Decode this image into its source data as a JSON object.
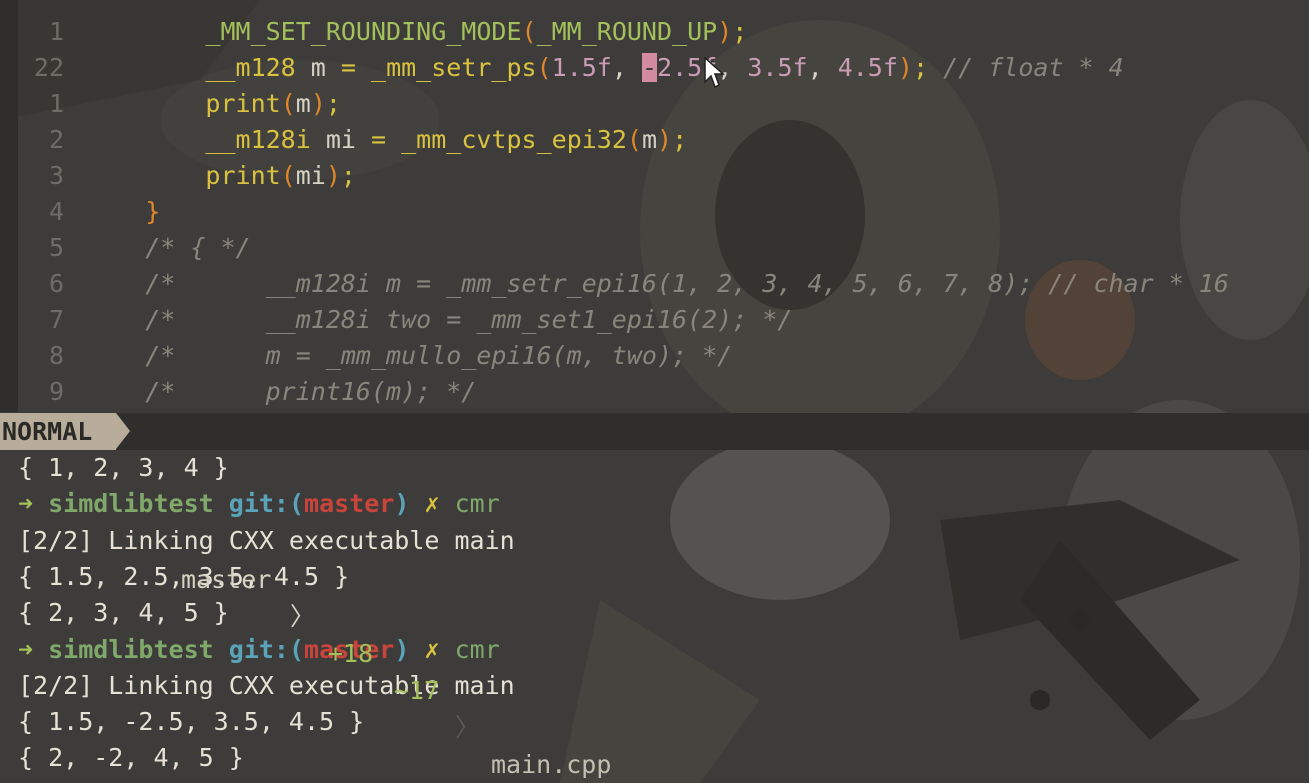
{
  "editor": {
    "lines": [
      {
        "num": "1",
        "tokens": [
          [
            "        ",
            "id"
          ],
          [
            "_MM_SET_ROUNDING_MODE",
            "kw-fn"
          ],
          [
            "(",
            "paren"
          ],
          [
            "_MM_ROUND_UP",
            "kw-fn"
          ],
          [
            ")",
            "paren"
          ],
          [
            ";",
            "op"
          ]
        ]
      },
      {
        "num": "22",
        "tokens": [
          [
            "        ",
            "id"
          ],
          [
            "__m128",
            "kw-fn2"
          ],
          [
            " m ",
            "id"
          ],
          [
            "=",
            "op"
          ],
          [
            " ",
            "id"
          ],
          [
            "_mm_setr_ps",
            "kw-fn2"
          ],
          [
            "(",
            "paren"
          ],
          [
            "1.5f",
            "num"
          ],
          [
            ", ",
            "id"
          ],
          [
            "-",
            "cursor-block"
          ],
          [
            "2.5f",
            "num"
          ],
          [
            ", ",
            "id"
          ],
          [
            "3.5f",
            "num"
          ],
          [
            ", ",
            "id"
          ],
          [
            "4.5f",
            "num"
          ],
          [
            ")",
            "paren"
          ],
          [
            ";",
            "op"
          ],
          [
            " // float * 4",
            "cm"
          ]
        ]
      },
      {
        "num": "1",
        "tokens": [
          [
            "        ",
            "id"
          ],
          [
            "print",
            "kw-fn2"
          ],
          [
            "(",
            "paren"
          ],
          [
            "m",
            "id"
          ],
          [
            ")",
            "paren"
          ],
          [
            ";",
            "op"
          ]
        ]
      },
      {
        "num": "2",
        "tokens": [
          [
            "        ",
            "id"
          ],
          [
            "__m128i",
            "kw-fn2"
          ],
          [
            " mi ",
            "id"
          ],
          [
            "=",
            "op"
          ],
          [
            " ",
            "id"
          ],
          [
            "_mm_cvtps_epi32",
            "kw-fn2"
          ],
          [
            "(",
            "paren"
          ],
          [
            "m",
            "id"
          ],
          [
            ")",
            "paren"
          ],
          [
            ";",
            "op"
          ]
        ]
      },
      {
        "num": "3",
        "tokens": [
          [
            "        ",
            "id"
          ],
          [
            "print",
            "kw-fn2"
          ],
          [
            "(",
            "paren"
          ],
          [
            "mi",
            "id"
          ],
          [
            ")",
            "paren"
          ],
          [
            ";",
            "op"
          ]
        ]
      },
      {
        "num": "4",
        "tokens": [
          [
            "    ",
            "id"
          ],
          [
            "}",
            "paren"
          ]
        ]
      },
      {
        "num": "5",
        "tokens": [
          [
            "    ",
            "id"
          ],
          [
            "/* { */",
            "cm"
          ]
        ]
      },
      {
        "num": "6",
        "tokens": [
          [
            "    ",
            "id"
          ],
          [
            "/*      __m128i m = _mm_setr_epi16(1, 2, 3, 4, 5, 6, 7, 8); // char * 16",
            "cm"
          ]
        ]
      },
      {
        "num": "7",
        "tokens": [
          [
            "    ",
            "id"
          ],
          [
            "/*      __m128i two = _mm_set1_epi16(2); */",
            "cm"
          ]
        ]
      },
      {
        "num": "8",
        "tokens": [
          [
            "    ",
            "id"
          ],
          [
            "/*      m = _mm_mullo_epi16(m, two); */",
            "cm"
          ]
        ]
      },
      {
        "num": "9",
        "tokens": [
          [
            "    ",
            "id"
          ],
          [
            "/*      print16(m); */",
            "cm"
          ]
        ]
      }
    ]
  },
  "statusline": {
    "mode": "NORMAL",
    "branch_icon": "",
    "branch": "master",
    "separator": "〉",
    "added": "+18",
    "modified": "~17",
    "filename": "main.cpp"
  },
  "terminal": {
    "lines": [
      {
        "kind": "out",
        "text": "{ 1, 2, 3, 4 }"
      },
      {
        "kind": "prompt",
        "arrow": "➜",
        "dir": "simdlibtest",
        "git_open": "git:(",
        "branch": "master",
        "git_close": ")",
        "x": "✗",
        "cmd": "cmr"
      },
      {
        "kind": "out",
        "text": "[2/2] Linking CXX executable main"
      },
      {
        "kind": "out",
        "text": "{ 1.5, 2.5, 3.5, 4.5 }"
      },
      {
        "kind": "out",
        "text": "{ 2, 3, 4, 5 }"
      },
      {
        "kind": "prompt",
        "arrow": "➜",
        "dir": "simdlibtest",
        "git_open": "git:(",
        "branch": "master",
        "git_close": ")",
        "x": "✗",
        "cmd": "cmr"
      },
      {
        "kind": "out",
        "text": "[2/2] Linking CXX executable main"
      },
      {
        "kind": "out",
        "text": "{ 1.5, -2.5, 3.5, 4.5 }"
      },
      {
        "kind": "out",
        "text": "{ 2, -2, 4, 5 }"
      }
    ]
  }
}
